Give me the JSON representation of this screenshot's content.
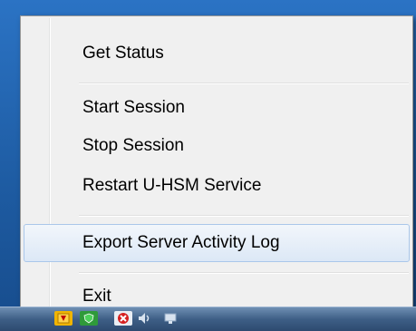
{
  "menu": {
    "items": [
      {
        "label": "Get Status"
      },
      {
        "label": "Start Session"
      },
      {
        "label": "Stop Session"
      },
      {
        "label": "Restart U-HSM Service"
      },
      {
        "label": "Export Server Activity Log",
        "highlighted": true
      },
      {
        "label": "Exit"
      }
    ]
  },
  "taskbar": {
    "icons": [
      "ticket-app-icon",
      "green-shield-icon",
      "red-x-icon",
      "speaker-icon",
      "network-icon"
    ]
  },
  "colors": {
    "menu_background": "#f0f0f0",
    "hover_background": "#dce8f6",
    "hover_border": "#aac7ea",
    "desktop": "#1e5fa6"
  }
}
